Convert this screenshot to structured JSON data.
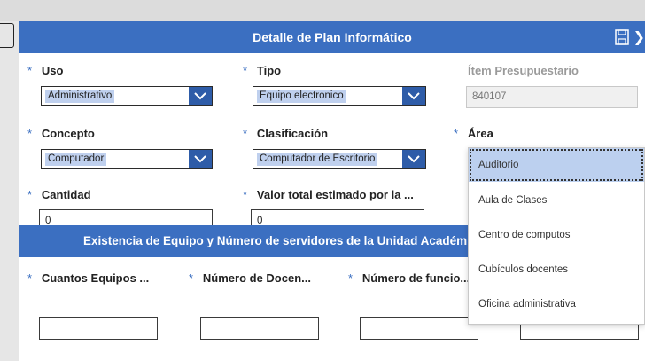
{
  "header": {
    "title": "Detalle de Plan Informático"
  },
  "form": {
    "uso": {
      "label": "Uso",
      "value": "Administrativo"
    },
    "tipo": {
      "label": "Tipo",
      "value": "Equipo electronico"
    },
    "item": {
      "label": "Ítem Presupuestario",
      "value": "840107"
    },
    "concepto": {
      "label": "Concepto",
      "value": "Computador"
    },
    "clasificacion": {
      "label": "Clasificación",
      "value": "Computador de Escritorio"
    },
    "area": {
      "label": "Área"
    },
    "cantidad": {
      "label": "Cantidad",
      "value": "0"
    },
    "valor": {
      "label": "Valor total estimado por la ...",
      "value": "0"
    }
  },
  "section2": {
    "title": "Existencia de Equipo y Número de servidores de la Unidad Académica",
    "fields": [
      {
        "label": "Cuantos Equipos ..."
      },
      {
        "label": "Número de Docen..."
      },
      {
        "label": "Número de funcio..."
      }
    ]
  },
  "area_dropdown": {
    "options": [
      "Auditorio",
      "Aula de Clases",
      "Centro de computos",
      "Cubículos docentes",
      "Oficina administrativa"
    ],
    "selected": "Auditorio"
  },
  "required_mark": "*",
  "colors": {
    "header": "#3b6fc1",
    "dropdown_button": "#2e5ca8",
    "selection": "#bfd0ee"
  },
  "icons": [
    "save-icon",
    "close-icon",
    "chevron-down-icon"
  ]
}
